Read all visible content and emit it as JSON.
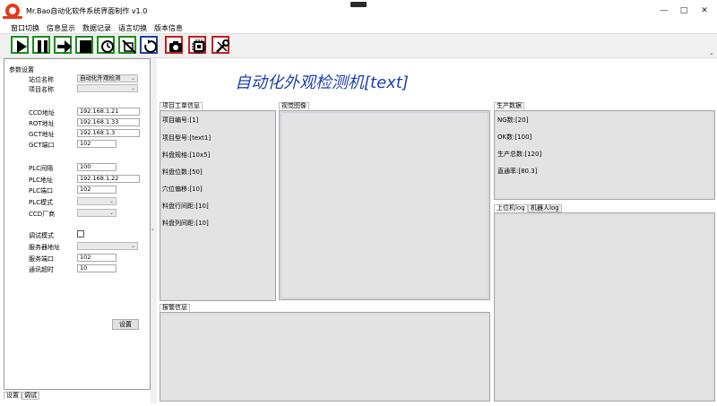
{
  "window": {
    "title": "Mr.Bao自动化软件系统界面制作 v1.0",
    "controls": {
      "minimize": "—",
      "maximize": "□",
      "close": "✕"
    }
  },
  "menu": [
    "窗口切换",
    "信息显示",
    "数据记录",
    "语言切换",
    "版本信息"
  ],
  "toolbar": {
    "buttons": [
      {
        "name": "run-icon",
        "color": "#1e8c1e"
      },
      {
        "name": "pause-icon",
        "color": "#1e8c1e"
      },
      {
        "name": "next-step-icon",
        "color": "#1e8c1e"
      },
      {
        "name": "stop-icon",
        "color": "#1e8c1e"
      },
      {
        "name": "alarm-clock-icon",
        "color": "#1e8c1e"
      },
      {
        "name": "disable-icon",
        "color": "#1e8c1e"
      },
      {
        "name": "reset-icon",
        "color": "#1d3fa8"
      },
      {
        "name": "camera-icon",
        "color": "#c81e1e"
      },
      {
        "name": "chip-icon",
        "color": "#c81e1e"
      },
      {
        "name": "tools-icon",
        "color": "#c81e1e"
      }
    ],
    "overflow": "»"
  },
  "left_panel": {
    "group_title": "参数设置",
    "station_label": "站位名称",
    "station_value": "自动化外观检测",
    "project_label": "项目名称",
    "project_value": "",
    "ccd_label": "CCD地址",
    "ccd_value": "192.168.1.21",
    "robot_label": "ROT地址",
    "robot_value": "192.168.1.33",
    "gct_addr_label": "GCT地址",
    "gct_addr_value": "192.168.1.3",
    "gct_port_label": "GCT端口",
    "gct_port_value": "102",
    "plc_interval_label": "PLC间隔",
    "plc_interval_value": "100",
    "plc_addr_label": "PLC地址",
    "plc_addr_value": "192.168.1.22",
    "plc_port_label": "PLC端口",
    "plc_port_value": "102",
    "plc_mode_label": "PLC模式",
    "plc_mode_value": "",
    "ccd_vendor_label": "CCD厂商",
    "ccd_vendor_value": "",
    "debug_label": "调试模式",
    "server_addr_label": "服务器地址",
    "server_addr_value": "",
    "server_port_label": "服务端口",
    "server_port_value": "102",
    "timeout_label": "通讯超时",
    "timeout_value": "10",
    "settings_button": "设置",
    "tabs": [
      "设置",
      "调试"
    ]
  },
  "headline": "自动化外观检测机[text]",
  "work_order": {
    "tab": "项目工单信息",
    "lines": [
      "项目编号:[1]",
      "项目型号:[text1]",
      "料盘规格:[10x5]",
      "料盘位数:[50]",
      "穴位偏移:[10]",
      "料盘行间距:[10]",
      "料盘列间距:[10]"
    ]
  },
  "image_panel": {
    "tab": "视觉图像"
  },
  "production": {
    "tab": "生产数据",
    "lines": [
      "NG数:[20]",
      "OK数:[100]",
      "生产总数:[120]",
      "直通率:[80.3]"
    ]
  },
  "log_tabs": [
    "上位机log",
    "机器人log"
  ],
  "alarm_panel": {
    "tab": "报警信息"
  }
}
